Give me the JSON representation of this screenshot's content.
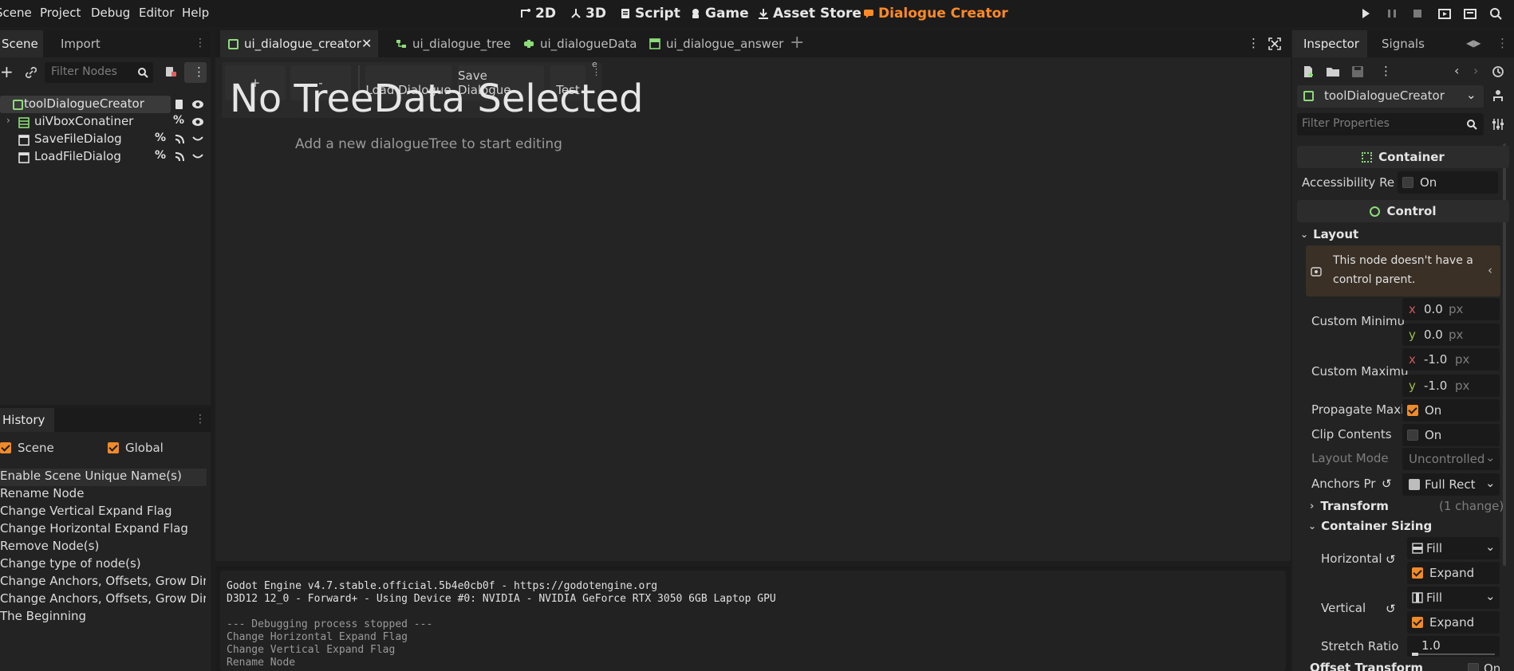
{
  "menu": [
    "Scene",
    "Project",
    "Debug",
    "Editor",
    "Help"
  ],
  "workspaces": [
    {
      "label": "2D",
      "icon": "2d-icon"
    },
    {
      "label": "3D",
      "icon": "3d-icon"
    },
    {
      "label": "Script",
      "icon": "script-icon"
    },
    {
      "label": "Game",
      "icon": "game-icon"
    },
    {
      "label": "Asset Store",
      "icon": "download-icon"
    },
    {
      "label": "Dialogue Creator",
      "icon": "dialogue-icon",
      "active": true
    }
  ],
  "scene_dock": {
    "tabs": [
      "Scene",
      "Import"
    ],
    "filter_placeholder": "Filter Nodes",
    "nodes": [
      {
        "name": "toolDialogueCreator"
      },
      {
        "name": "uiVboxConatiner"
      },
      {
        "name": "SaveFileDialog"
      },
      {
        "name": "LoadFileDialog"
      }
    ]
  },
  "history": {
    "tab": "History",
    "scene_label": "Scene",
    "global_label": "Global",
    "items": [
      "Enable Scene Unique Name(s)",
      "Rename Node",
      "Change Vertical Expand Flag",
      "Change Horizontal Expand Flag",
      "Remove Node(s)",
      "Change type of node(s)",
      "Change Anchors, Offsets, Grow Direc...",
      "Change Anchors, Offsets, Grow Direc...",
      "The Beginning"
    ]
  },
  "editor_tabs": [
    {
      "label": "ui_dialogue_creator",
      "active": true
    },
    {
      "label": "ui_dialogue_tree"
    },
    {
      "label": "ui_dialogueData"
    },
    {
      "label": "ui_dialogue_answer"
    }
  ],
  "plugin": {
    "add_label": "+",
    "remove_label": "-",
    "load_label": "Load Dialogue",
    "save_label": "Save Dialogue",
    "test_label": "Test",
    "big_title": "No TreeData Selected",
    "hint": "Add a new dialogueTree to start editing"
  },
  "output": [
    "Godot Engine v4.7.stable.official.5b4e0cb0f - https://godotengine.org",
    "D3D12 12_0 - Forward+ - Using Device #0: NVIDIA - NVIDIA GeForce RTX 3050 6GB Laptop GPU",
    "",
    "--- Debugging process stopped ---",
    "Change Horizontal Expand Flag",
    "Change Vertical Expand Flag",
    "Rename Node"
  ],
  "inspector": {
    "tabs": [
      "Inspector",
      "Signals"
    ],
    "node_name": "toolDialogueCreator",
    "filter_placeholder": "Filter Properties",
    "container_header": "Container",
    "accessibility_label": "Accessibility Re",
    "on_label": "On",
    "control_header": "Control",
    "layout_label": "Layout",
    "warning": "This node doesn't have a control parent.",
    "custom_min_label": "Custom Minimu",
    "custom_min_x": "0.0",
    "custom_min_y": "0.0",
    "custom_max_label": "Custom Maximu",
    "custom_max_x": "-1.0",
    "custom_max_y": "-1.0",
    "unit": "px",
    "x_label": "x",
    "y_label": "y",
    "propagate_label": "Propagate Maxi",
    "clip_label": "Clip Contents",
    "layout_mode_label": "Layout Mode",
    "layout_mode_value": "Uncontrolled",
    "anchors_label": "Anchors Pr",
    "anchors_value": "Full Rect",
    "transform_label": "Transform",
    "transform_changes": "(1 change)",
    "container_sizing_label": "Container Sizing",
    "horizontal_label": "Horizontal",
    "vertical_label": "Vertical",
    "fill_label": "Fill",
    "expand_label": "Expand",
    "stretch_label": "Stretch Ratio",
    "stretch_value": "1.0",
    "offset_transform_label": "Offset Transform",
    "offset_on_label": "On"
  }
}
